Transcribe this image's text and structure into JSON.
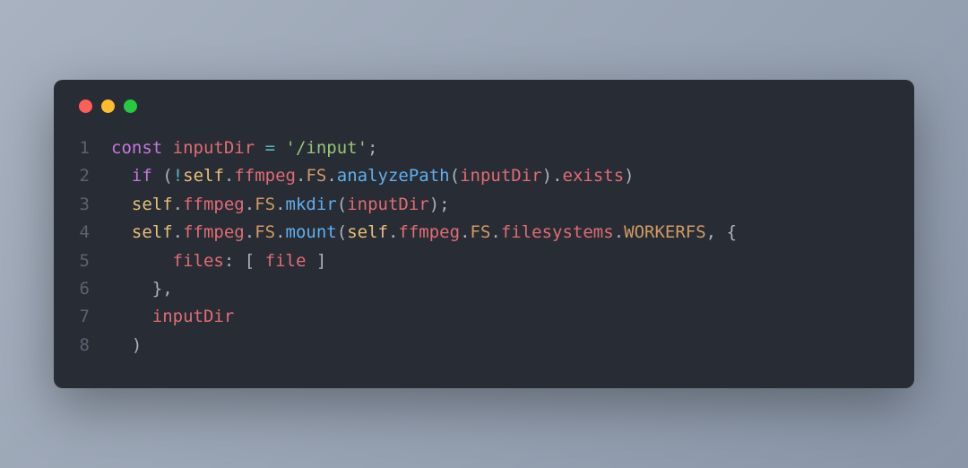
{
  "window": {
    "traffic_lights": [
      "red",
      "yellow",
      "green"
    ]
  },
  "code": {
    "lines": [
      {
        "n": "1",
        "tokens": [
          {
            "cls": "tok-keyword",
            "t": "const"
          },
          {
            "cls": "tok-default",
            "t": " ",
            "ws": true
          },
          {
            "cls": "tok-variable",
            "t": "inputDir"
          },
          {
            "cls": "tok-default",
            "t": " ",
            "ws": true
          },
          {
            "cls": "tok-operator",
            "t": "="
          },
          {
            "cls": "tok-default",
            "t": " ",
            "ws": true
          },
          {
            "cls": "tok-string",
            "t": "'/input'"
          },
          {
            "cls": "tok-punct",
            "t": ";"
          }
        ]
      },
      {
        "n": "2",
        "tokens": [
          {
            "cls": "tok-default",
            "t": "  ",
            "ws": true
          },
          {
            "cls": "tok-keyword",
            "t": "if"
          },
          {
            "cls": "tok-default",
            "t": " ",
            "ws": true
          },
          {
            "cls": "tok-punct",
            "t": "("
          },
          {
            "cls": "tok-operator",
            "t": "!"
          },
          {
            "cls": "tok-self",
            "t": "self"
          },
          {
            "cls": "tok-punct",
            "t": "."
          },
          {
            "cls": "tok-property",
            "t": "ffmpeg"
          },
          {
            "cls": "tok-punct",
            "t": "."
          },
          {
            "cls": "tok-constant",
            "t": "FS"
          },
          {
            "cls": "tok-punct",
            "t": "."
          },
          {
            "cls": "tok-function",
            "t": "analyzePath"
          },
          {
            "cls": "tok-punct",
            "t": "("
          },
          {
            "cls": "tok-variable",
            "t": "inputDir"
          },
          {
            "cls": "tok-punct",
            "t": ")"
          },
          {
            "cls": "tok-punct",
            "t": "."
          },
          {
            "cls": "tok-property",
            "t": "exists"
          },
          {
            "cls": "tok-punct",
            "t": ")"
          }
        ]
      },
      {
        "n": "3",
        "tokens": [
          {
            "cls": "tok-default",
            "t": "  ",
            "ws": true
          },
          {
            "cls": "tok-self",
            "t": "self"
          },
          {
            "cls": "tok-punct",
            "t": "."
          },
          {
            "cls": "tok-property",
            "t": "ffmpeg"
          },
          {
            "cls": "tok-punct",
            "t": "."
          },
          {
            "cls": "tok-constant",
            "t": "FS"
          },
          {
            "cls": "tok-punct",
            "t": "."
          },
          {
            "cls": "tok-function",
            "t": "mkdir"
          },
          {
            "cls": "tok-punct",
            "t": "("
          },
          {
            "cls": "tok-variable",
            "t": "inputDir"
          },
          {
            "cls": "tok-punct",
            "t": ")"
          },
          {
            "cls": "tok-punct",
            "t": ";"
          }
        ]
      },
      {
        "n": "4",
        "tokens": [
          {
            "cls": "tok-default",
            "t": "  ",
            "ws": true
          },
          {
            "cls": "tok-self",
            "t": "self"
          },
          {
            "cls": "tok-punct",
            "t": "."
          },
          {
            "cls": "tok-property",
            "t": "ffmpeg"
          },
          {
            "cls": "tok-punct",
            "t": "."
          },
          {
            "cls": "tok-constant",
            "t": "FS"
          },
          {
            "cls": "tok-punct",
            "t": "."
          },
          {
            "cls": "tok-function",
            "t": "mount"
          },
          {
            "cls": "tok-punct",
            "t": "("
          },
          {
            "cls": "tok-self",
            "t": "self"
          },
          {
            "cls": "tok-punct",
            "t": "."
          },
          {
            "cls": "tok-property",
            "t": "ffmpeg"
          },
          {
            "cls": "tok-punct",
            "t": "."
          },
          {
            "cls": "tok-constant",
            "t": "FS"
          },
          {
            "cls": "tok-punct",
            "t": "."
          },
          {
            "cls": "tok-property",
            "t": "filesystems"
          },
          {
            "cls": "tok-punct",
            "t": "."
          },
          {
            "cls": "tok-constant",
            "t": "WORKERFS"
          },
          {
            "cls": "tok-punct",
            "t": ","
          },
          {
            "cls": "tok-default",
            "t": " ",
            "ws": true
          },
          {
            "cls": "tok-punct",
            "t": "{"
          }
        ]
      },
      {
        "n": "5",
        "tokens": [
          {
            "cls": "tok-default",
            "t": "      ",
            "ws": true
          },
          {
            "cls": "tok-property",
            "t": "files"
          },
          {
            "cls": "tok-punct",
            "t": ":"
          },
          {
            "cls": "tok-default",
            "t": " ",
            "ws": true
          },
          {
            "cls": "tok-punct",
            "t": "["
          },
          {
            "cls": "tok-default",
            "t": " ",
            "ws": true
          },
          {
            "cls": "tok-variable",
            "t": "file"
          },
          {
            "cls": "tok-default",
            "t": " ",
            "ws": true
          },
          {
            "cls": "tok-punct",
            "t": "]"
          }
        ]
      },
      {
        "n": "6",
        "tokens": [
          {
            "cls": "tok-default",
            "t": "    ",
            "ws": true
          },
          {
            "cls": "tok-punct",
            "t": "}"
          },
          {
            "cls": "tok-punct",
            "t": ","
          }
        ]
      },
      {
        "n": "7",
        "tokens": [
          {
            "cls": "tok-default",
            "t": "    ",
            "ws": true
          },
          {
            "cls": "tok-variable",
            "t": "inputDir"
          }
        ]
      },
      {
        "n": "8",
        "tokens": [
          {
            "cls": "tok-default",
            "t": "  ",
            "ws": true
          },
          {
            "cls": "tok-punct",
            "t": ")"
          }
        ]
      }
    ]
  }
}
